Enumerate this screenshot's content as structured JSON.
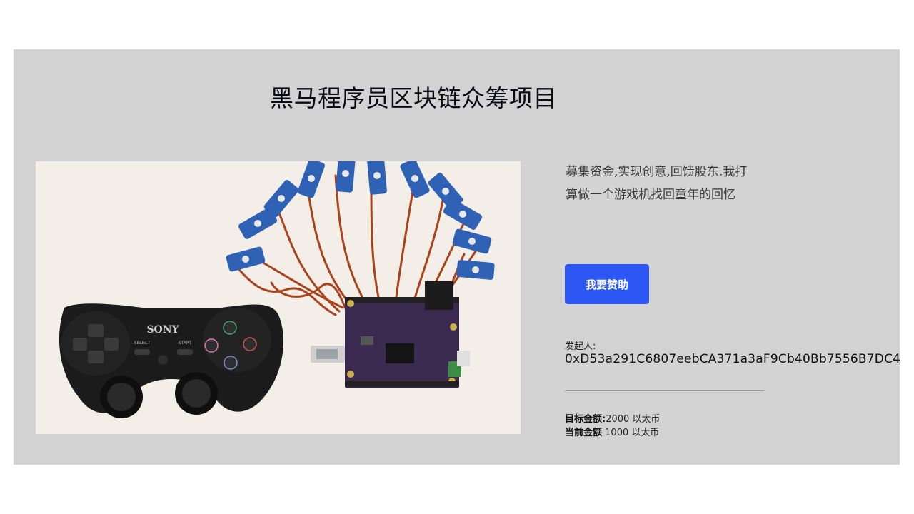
{
  "project": {
    "title": "黑马程序员区块链众筹项目",
    "description": "募集资金,实现创意,回馈股东.我打算做一个游戏机找回童年的回忆",
    "image": {
      "controller_brand": "SONY",
      "controller_select": "SELECT",
      "controller_start": "START"
    },
    "sponsor_button": "我要赞助",
    "initiator_label": "发起人:",
    "initiator_address": "0xD53a291C6807eebCA371a3aF9Cb40Bb7556B7DC4",
    "target_label": "目标金额:",
    "target_value": "2000 以太币",
    "current_label": "当前金额",
    "current_value": "1000 以太币"
  },
  "colors": {
    "panel_bg": "#d3d3d3",
    "button_bg": "#2d57f5",
    "button_text": "#ffffff"
  }
}
